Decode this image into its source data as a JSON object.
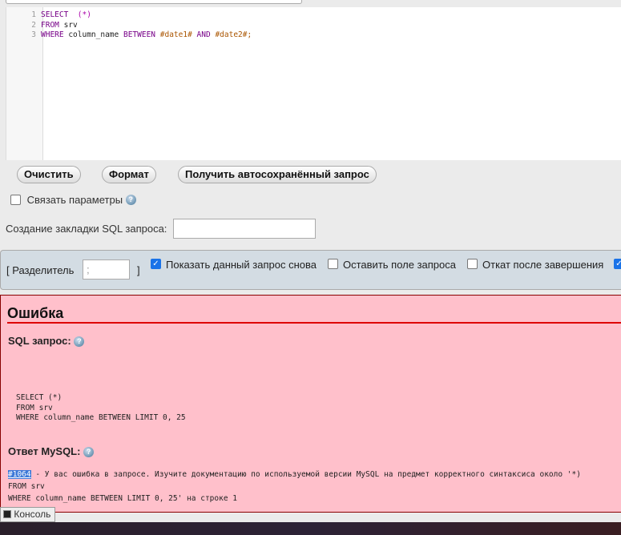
{
  "editor": {
    "lines": [
      {
        "n": "1",
        "parts": [
          [
            "kw",
            "SELECT"
          ],
          [
            "pl",
            "  "
          ],
          [
            "op",
            "(*)"
          ]
        ]
      },
      {
        "n": "2",
        "parts": [
          [
            "kw",
            "FROM"
          ],
          [
            "pl",
            " srv"
          ]
        ]
      },
      {
        "n": "3",
        "parts": [
          [
            "kw",
            "WHERE"
          ],
          [
            "pl",
            " column_name "
          ],
          [
            "kw",
            "BETWEEN"
          ],
          [
            "pl",
            " "
          ],
          [
            "str",
            "#date1#"
          ],
          [
            "pl",
            " "
          ],
          [
            "kw",
            "AND"
          ],
          [
            "pl",
            " "
          ],
          [
            "str",
            "#date2#;"
          ]
        ]
      }
    ]
  },
  "buttons": {
    "clear": "Очистить",
    "format": "Формат",
    "autosave": "Получить автосохранённый запрос"
  },
  "bind_params": "Связать параметры",
  "bookmark": {
    "label": "Создание закладки SQL запроса:",
    "value": ""
  },
  "options": {
    "delimiter_open": "[ Разделитель",
    "delimiter_value": ";",
    "delimiter_close": "]",
    "show_query": "Показать данный запрос снова",
    "retain_box": "Оставить поле запроса",
    "rollback": "Откат после завершения"
  },
  "error": {
    "title": "Ошибка",
    "sql_label": "SQL запрос:",
    "sql_lines": [
      "SELECT  (*)",
      "FROM srv",
      "WHERE column_name BETWEEN LIMIT 0, 25"
    ],
    "response_label": "Ответ MySQL:",
    "code": "#1064",
    "message": " - У вас ошибка в запросе. Изучите документацию по используемой версии MySQL на предмет корректного синтаксиса около '*)",
    "msg_lines": [
      "FROM srv",
      "WHERE column_name BETWEEN LIMIT 0, 25' на строке 1"
    ]
  },
  "console": "Консоль"
}
